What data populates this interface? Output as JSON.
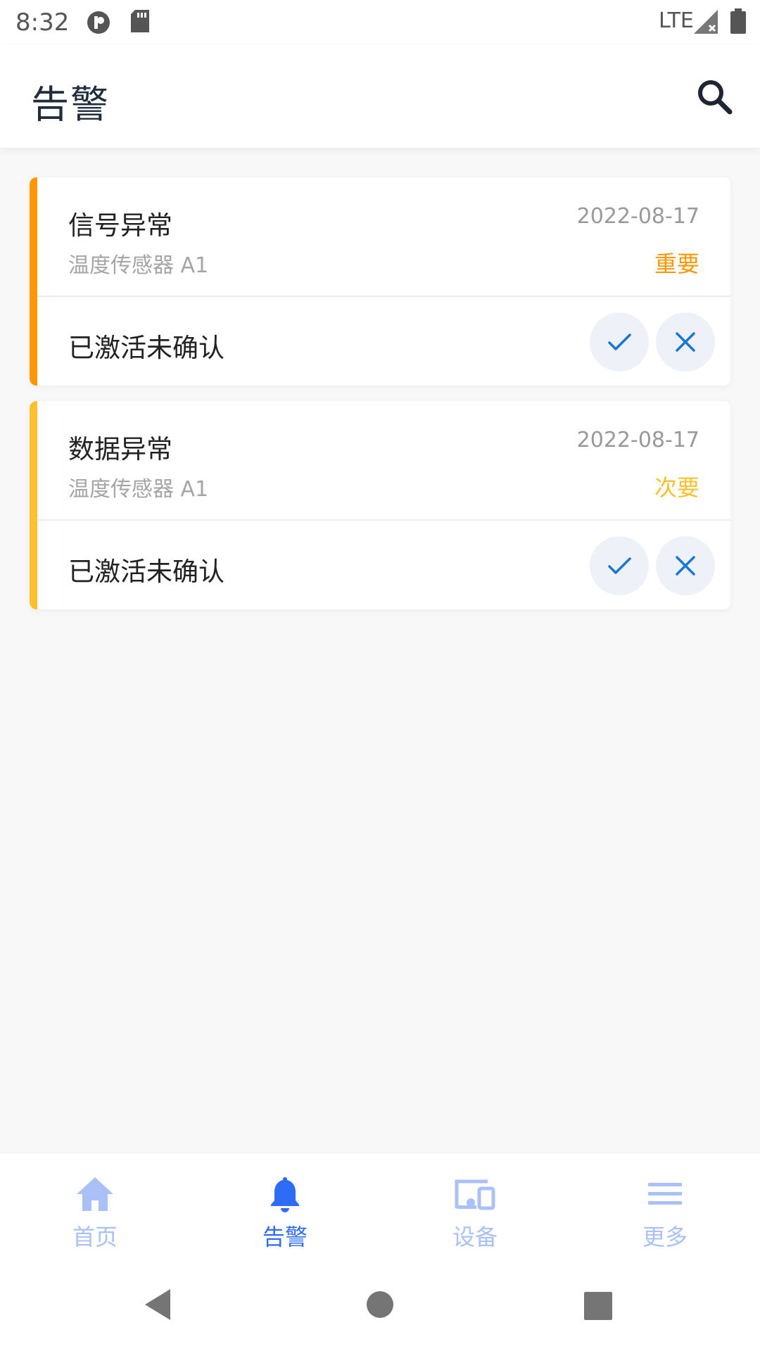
{
  "status_bar": {
    "time": "8:32",
    "network": "LTE"
  },
  "header": {
    "title": "告警"
  },
  "alarms": [
    {
      "name": "信号异常",
      "device": "温度传感器 A1",
      "date": "2022-08-17",
      "severity": "重要",
      "status": "已激活未确认",
      "accent_color": "#ff9800"
    },
    {
      "name": "数据异常",
      "device": "温度传感器 A1",
      "date": "2022-08-17",
      "severity": "次要",
      "status": "已激活未确认",
      "accent_color": "#fbc02d"
    }
  ],
  "nav": {
    "items": [
      {
        "label": "首页",
        "icon": "home-icon"
      },
      {
        "label": "告警",
        "icon": "bell-icon"
      },
      {
        "label": "设备",
        "icon": "devices-icon"
      },
      {
        "label": "更多",
        "icon": "menu-icon"
      }
    ],
    "active_index": 1,
    "active_color": "#2f6cf6",
    "inactive_color": "#a9c1f6"
  },
  "colors": {
    "action_icon": "#1976d2",
    "action_bg": "#eef2f8"
  }
}
